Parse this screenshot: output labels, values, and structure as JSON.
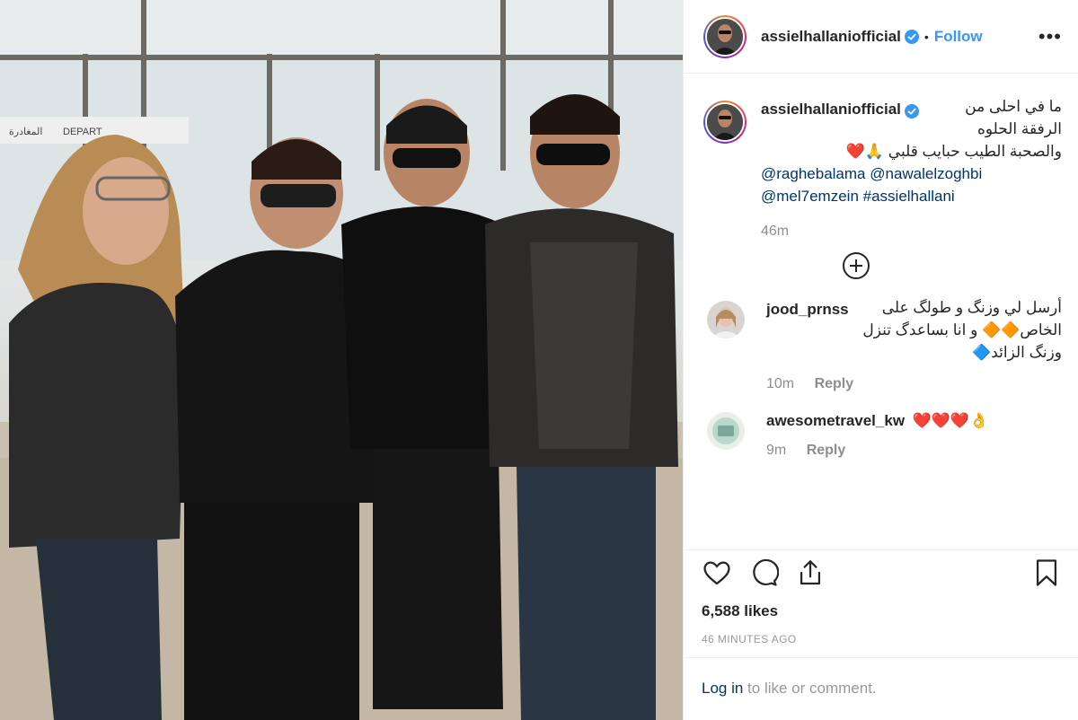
{
  "post": {
    "username": "assielhallaniofficial",
    "follow_label": "Follow",
    "separator": "•",
    "more_label": "•••"
  },
  "caption": {
    "username": "assielhallaniofficial",
    "line1": "ما في احلى من الرفقة الحلوه",
    "line2": "والصحبة الطيب حبايب قلبي 🙏❤️",
    "tags": [
      "@raghebalama",
      "@nawalelzoghbi",
      "@mel7emzein",
      "#assielhallani"
    ],
    "time": "46m"
  },
  "comments": [
    {
      "username": "jood_prnss",
      "text": "أرسل لي وزنگ و طولگ على الخاص🔶🔶 و انا بساعدگ تنزل وزنگ الزائد🔷",
      "time": "10m",
      "reply_label": "Reply"
    },
    {
      "username": "awesometravel_kw",
      "text": "❤️❤️❤️👌",
      "time": "9m",
      "reply_label": "Reply"
    }
  ],
  "stats": {
    "likes": "6,588 likes",
    "posted": "46 MINUTES AGO"
  },
  "footer": {
    "login_link": "Log in",
    "login_rest": " to like or comment."
  },
  "photo": {
    "sign_text": "DEPART",
    "sign_arabic": "المغادرة"
  },
  "icons": {
    "verified": "verified-badge-icon",
    "like": "heart-icon",
    "comment": "comment-bubble-icon",
    "share": "share-icon",
    "save": "bookmark-icon",
    "add": "plus-circle-icon"
  },
  "colors": {
    "link": "#3897f0",
    "tag": "#003569",
    "muted": "#8e8e8e"
  }
}
